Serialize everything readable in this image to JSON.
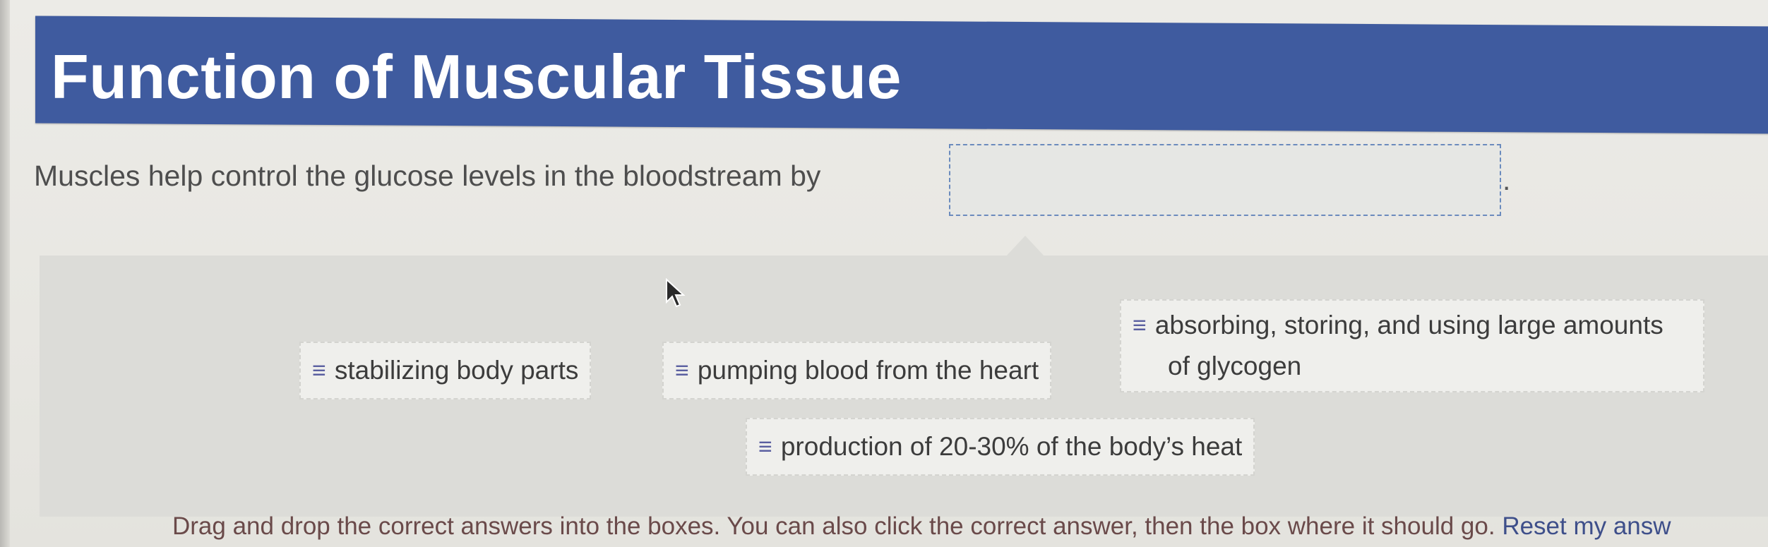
{
  "header": {
    "title": "Function of Muscular Tissue"
  },
  "question": {
    "prompt": "Muscles help control the glucose levels in the bloodstream by",
    "suffix": ".",
    "blank_value": ""
  },
  "answers": [
    {
      "label": "stabilizing body parts"
    },
    {
      "label": "pumping blood from the heart"
    },
    {
      "line1": "absorbing, storing, and using large amounts",
      "line2": "of glycogen"
    },
    {
      "label": "production of 20-30% of the body’s heat"
    }
  ],
  "icons": {
    "grip": "≡",
    "grip_name": "drag-handle-icon"
  },
  "footer": {
    "instructions": "Drag and drop the correct answers into the boxes. You can also click the correct answer, then the box where it should go.",
    "reset_label": "Reset my answ"
  },
  "colors": {
    "title_bar": "#3f5b9f",
    "drop_border": "#6b8bbd",
    "grip": "#5a5fa0"
  }
}
